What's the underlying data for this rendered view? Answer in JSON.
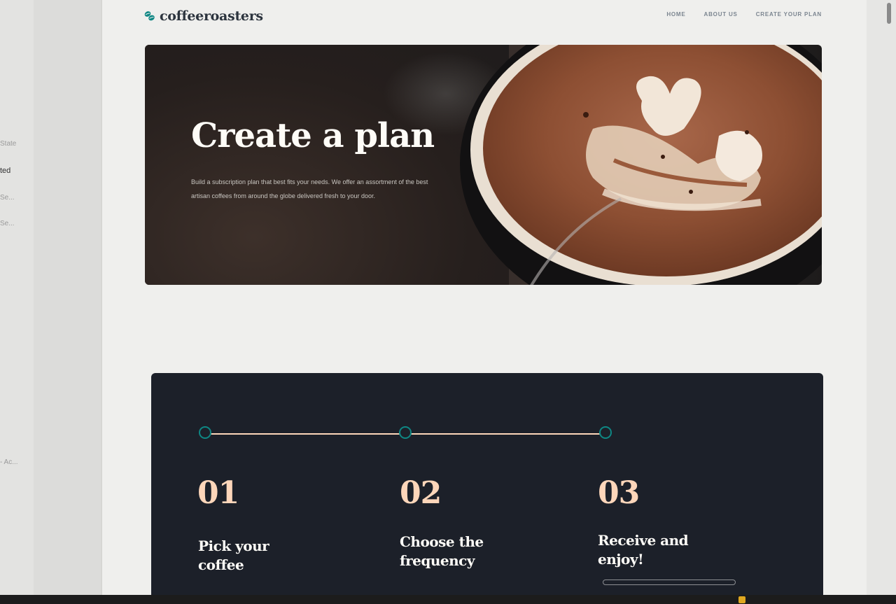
{
  "editor_panel": {
    "items": [
      "State",
      "ted",
      "Se...",
      "Se...",
      "- Ac..."
    ]
  },
  "header": {
    "logo_text": "coffeeroasters",
    "nav": [
      "HOME",
      "ABOUT US",
      "CREATE YOUR PLAN"
    ]
  },
  "hero": {
    "title": "Create a plan",
    "description": "Build a subscription plan that best fits your needs. We offer an assortment of the best artisan coffees from around the globe delivered fresh to your door."
  },
  "steps": [
    {
      "number": "01",
      "title": "Pick your coffee"
    },
    {
      "number": "02",
      "title": "Choose the frequency"
    },
    {
      "number": "03",
      "title": "Receive and enjoy!"
    }
  ],
  "colors": {
    "dark_blue": "#2c343e",
    "dark_section": "#1c2029",
    "pale_orange": "#fdd6ba",
    "dark_cyan": "#0e8784",
    "light_cream": "#fefcf7"
  },
  "icons": {
    "logo": "coffee-bean-icon"
  }
}
